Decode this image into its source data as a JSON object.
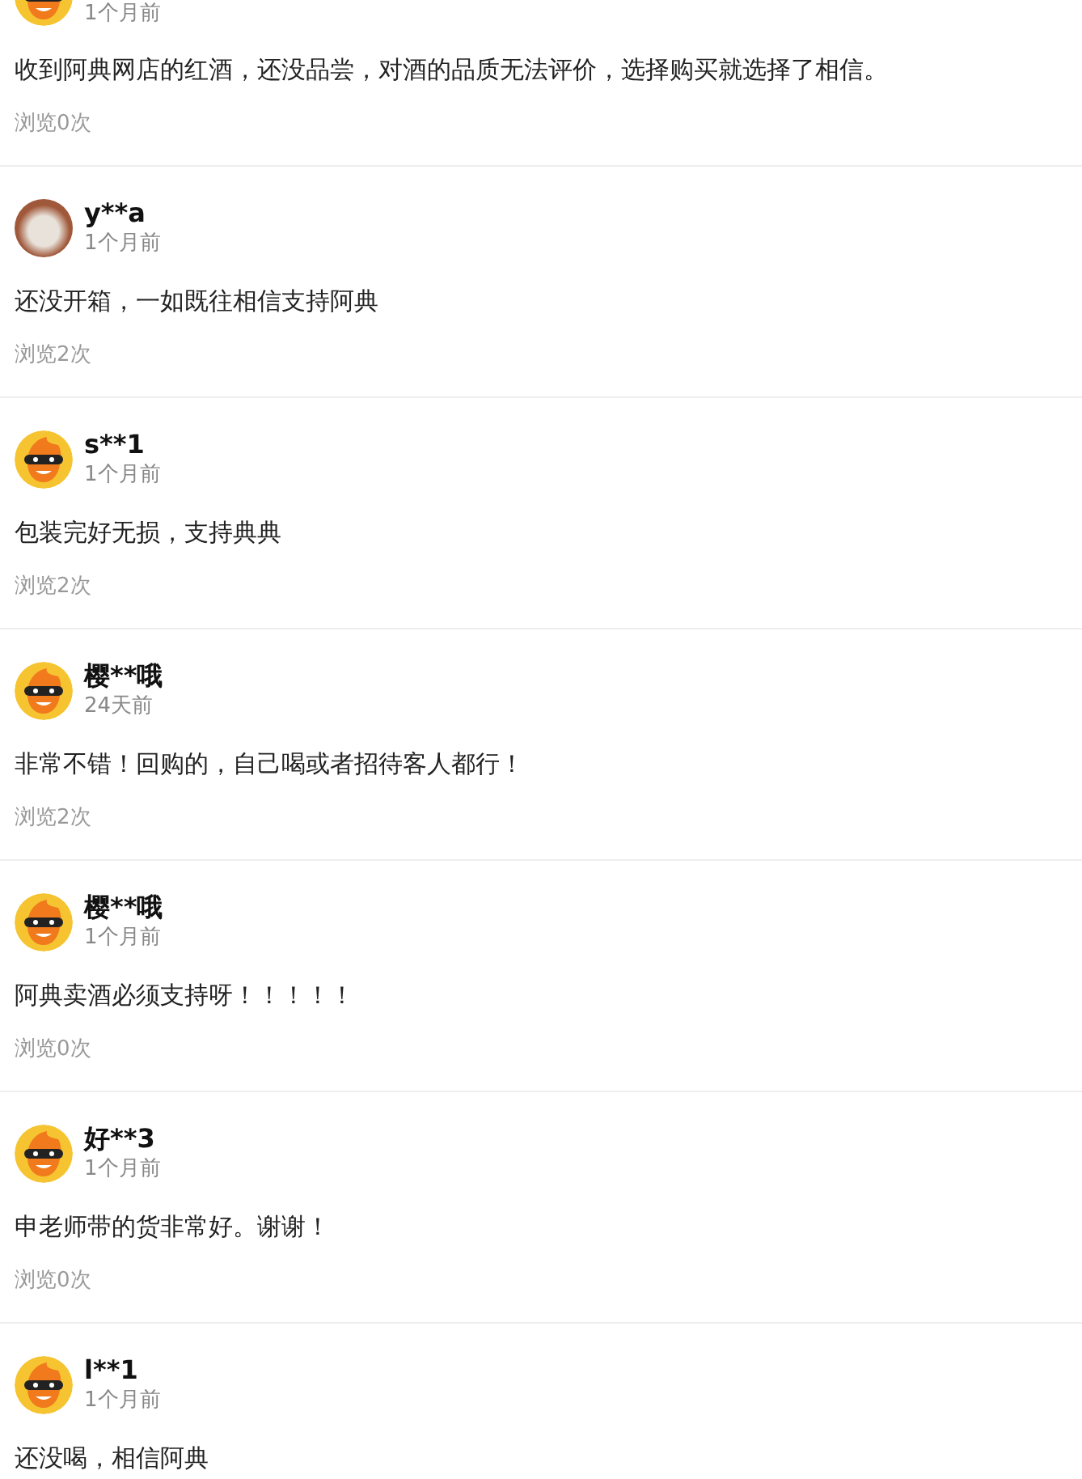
{
  "comments": [
    {
      "kind": "cartoon",
      "time": "1个月前",
      "text": "收到阿典网店的红酒，还没品尝，对酒的品质无法评价，选择购买就选择了相信。",
      "views": "浏览0次"
    },
    {
      "kind": "photo",
      "user": "y**a",
      "time": "1个月前",
      "text": "还没开箱，一如既往相信支持阿典",
      "views": "浏览2次"
    },
    {
      "kind": "cartoon",
      "user": "s**1",
      "time": "1个月前",
      "text": "包装完好无损，支持典典",
      "views": "浏览2次"
    },
    {
      "kind": "cartoon",
      "user": "樱**哦",
      "time": "24天前",
      "text": "非常不错！回购的，自己喝或者招待客人都行！",
      "views": "浏览2次"
    },
    {
      "kind": "cartoon",
      "user": "樱**哦",
      "time": "1个月前",
      "text": "阿典卖酒必须支持呀！！！！！",
      "views": "浏览0次"
    },
    {
      "kind": "cartoon",
      "user": "好**3",
      "time": "1个月前",
      "text": "申老师带的货非常好。谢谢！",
      "views": "浏览0次"
    },
    {
      "kind": "cartoon",
      "user": "l**1",
      "time": "1个月前",
      "text": "还没喝，相信阿典"
    }
  ]
}
